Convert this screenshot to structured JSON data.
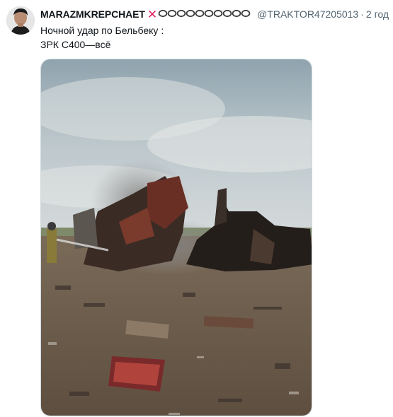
{
  "tweet": {
    "display_name": "MARAZMKREPCHAET",
    "name_suffix_icon": "red-x-mark",
    "decoration_icon": "ring-chain-emoji",
    "handle": "@TRAKTOR47205013",
    "separator": "·",
    "timestamp": "2 год",
    "text_lines": [
      "Ночной удар по Бельбеку :",
      "ЗРК С400—всё"
    ],
    "media": {
      "kind": "photo",
      "subject": "destroyed-vehicles-smoke-field"
    }
  },
  "colors": {
    "text": "#0f1419",
    "secondary": "#536471",
    "accent_red": "#e0245e",
    "border": "#cfd9de"
  }
}
